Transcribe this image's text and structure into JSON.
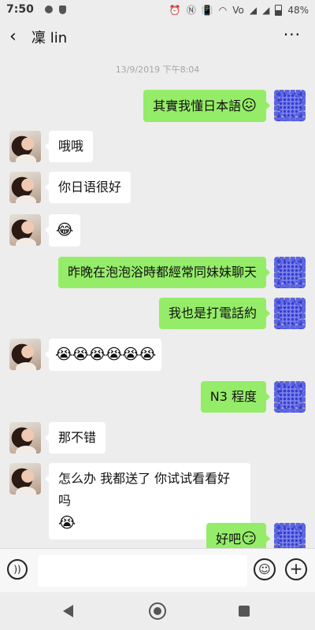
{
  "status_bar": {
    "time": "7:50",
    "network": "Vo",
    "battery": "48%"
  },
  "header": {
    "title": "凜 lin",
    "more": "···"
  },
  "timestamp": "13/9/2019 下午8:04",
  "messages": [
    {
      "from": "me",
      "text": "其實我懂日本語",
      "emoji": "😖"
    },
    {
      "from": "her",
      "text": "哦哦"
    },
    {
      "from": "her",
      "text": "你日语很好"
    },
    {
      "from": "her",
      "text": "",
      "emoji": "😂"
    },
    {
      "from": "me",
      "text": "昨晚在泡泡浴時都經常同妹妹聊天"
    },
    {
      "from": "me",
      "text": "我也是打電話約"
    },
    {
      "from": "her",
      "text": "",
      "emoji": "😭😭😭😭😭😭"
    },
    {
      "from": "me",
      "text": "N3 程度"
    },
    {
      "from": "her",
      "text": "那不错"
    },
    {
      "from": "her",
      "text": "怎么办 我都送了 你试试看看好吗",
      "emoji": "😭"
    },
    {
      "from": "me",
      "text": "好吧",
      "emoji": "😏"
    }
  ],
  "input_bar": {
    "voice_icon": "voice-icon",
    "emoji_icon": "emoji-icon",
    "plus_icon": "plus-icon",
    "text_value": ""
  }
}
